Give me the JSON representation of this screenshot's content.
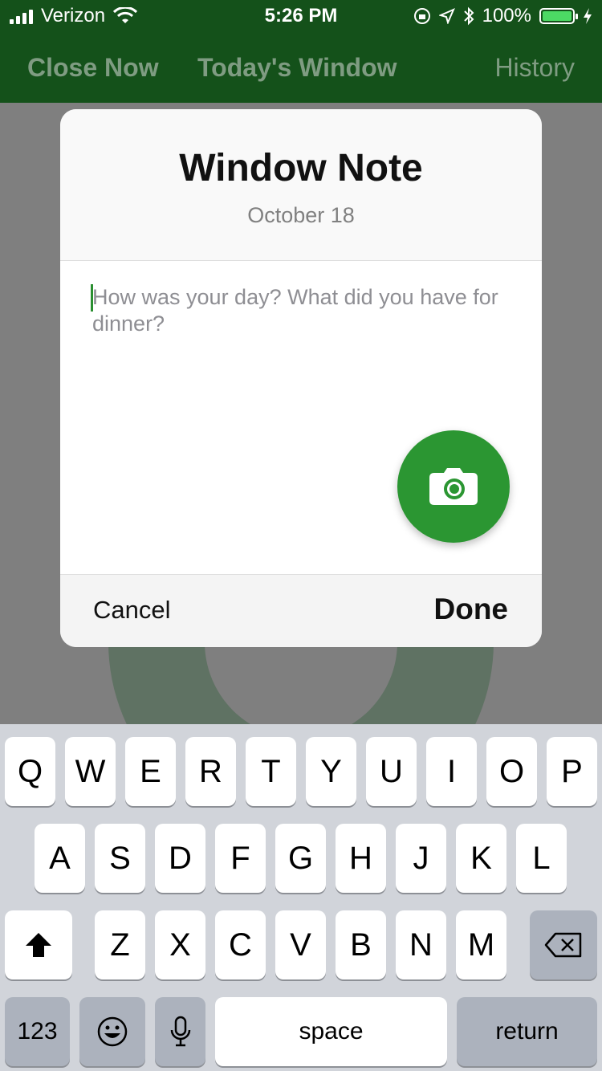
{
  "status_bar": {
    "carrier": "Verizon",
    "time": "5:26 PM",
    "battery": "100%",
    "battery_level": 1.0
  },
  "nav": {
    "close_now": "Close Now",
    "todays_window": "Today's Window",
    "history": "History"
  },
  "modal": {
    "title": "Window Note",
    "date": "October 18",
    "note_placeholder": "How was your day? What did you have for dinner?",
    "camera_icon": "camera-icon",
    "cancel_label": "Cancel",
    "done_label": "Done"
  },
  "keyboard": {
    "row1": [
      "Q",
      "W",
      "E",
      "R",
      "T",
      "Y",
      "U",
      "I",
      "O",
      "P"
    ],
    "row2": [
      "A",
      "S",
      "D",
      "F",
      "G",
      "H",
      "J",
      "K",
      "L"
    ],
    "row3": [
      "Z",
      "X",
      "C",
      "V",
      "B",
      "N",
      "M"
    ],
    "numbers_label": "123",
    "space_label": "space",
    "return_label": "return"
  },
  "colors": {
    "brand_green": "#14511a",
    "accent_green": "#2b9632"
  }
}
